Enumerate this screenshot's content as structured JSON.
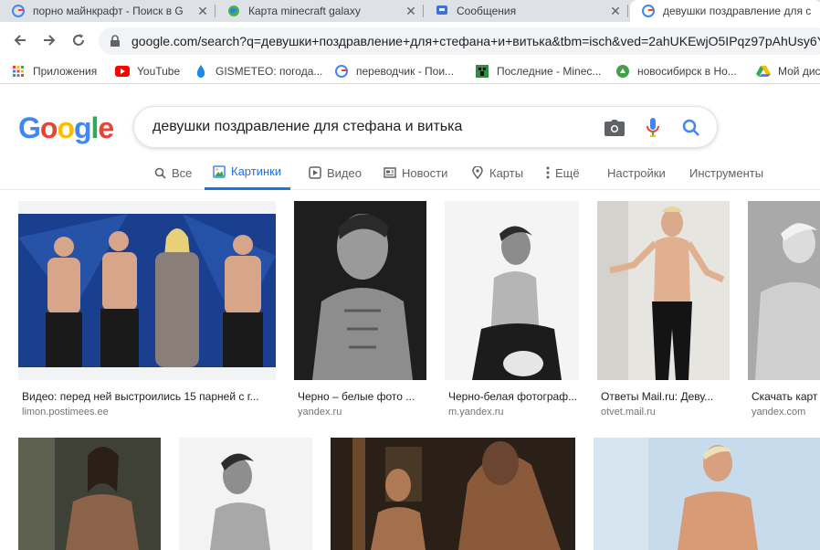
{
  "tabs": [
    {
      "title": "порно майнкрафт - Поиск в G",
      "favicon": "google-g-icon"
    },
    {
      "title": "Карта minecraft galaxy",
      "favicon": "globe-icon"
    },
    {
      "title": "Сообщения",
      "favicon": "chat-icon"
    },
    {
      "title": "девушки поздравление для с",
      "favicon": "google-g-icon"
    }
  ],
  "address": {
    "url": "google.com/search?q=девушки+поздравление+для+стефана+и+витька&tbm=isch&ved=2ahUKEwjO5IPqz97pAhUsy6Y"
  },
  "bookmarks": [
    {
      "label": "Приложения",
      "icon": "apps-grid-icon"
    },
    {
      "label": "YouTube",
      "icon": "youtube-icon"
    },
    {
      "label": "GISMETEO: погода...",
      "icon": "gismeteo-drop-icon"
    },
    {
      "label": "переводчик - Пои...",
      "icon": "google-g-icon"
    },
    {
      "label": "Последние - Minec...",
      "icon": "minecraft-icon"
    },
    {
      "label": "новосибирск в Но...",
      "icon": "green-logo-icon"
    },
    {
      "label": "Мой дис",
      "icon": "drive-icon"
    }
  ],
  "search": {
    "query": "девушки поздравление для стефана и витька"
  },
  "search_tabs": [
    {
      "label": "Все",
      "icon": "search-icon"
    },
    {
      "label": "Картинки",
      "icon": "image-icon"
    },
    {
      "label": "Видео",
      "icon": "video-icon"
    },
    {
      "label": "Новости",
      "icon": "news-icon"
    },
    {
      "label": "Карты",
      "icon": "map-pin-icon"
    },
    {
      "label": "Ещё",
      "icon": "more-vert-icon"
    },
    {
      "label": "Настройки"
    },
    {
      "label": "Инструменты"
    }
  ],
  "results": [
    {
      "caption": "Видео: перед ней выстроились 15 парней с г...",
      "source": "limon.postimees.ee"
    },
    {
      "caption": "Черно – белые фото ...",
      "source": "yandex.ru"
    },
    {
      "caption": "Черно-белая фотограф...",
      "source": "m.yandex.ru"
    },
    {
      "caption": "Ответы Mail.ru: Деву...",
      "source": "otvet.mail.ru"
    },
    {
      "caption": "Скачать карт",
      "source": "yandex.com"
    },
    {
      "caption": "",
      "source": ""
    },
    {
      "caption": "",
      "source": ""
    },
    {
      "caption": "",
      "source": ""
    },
    {
      "caption": "",
      "source": ""
    }
  ]
}
